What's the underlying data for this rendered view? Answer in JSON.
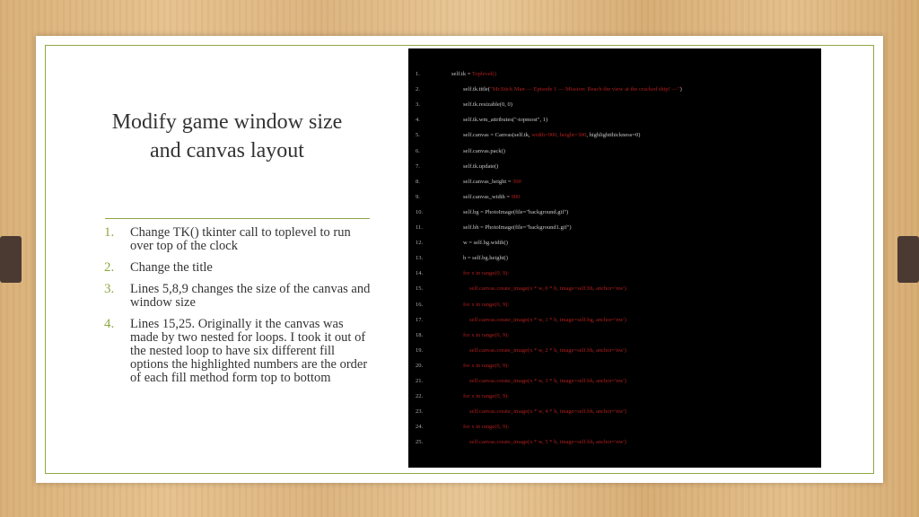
{
  "slide": {
    "title_line1": "Modify game window size",
    "title_line2": "and canvas layout"
  },
  "bullets": [
    {
      "num": "1.",
      "text": "Change TK() tkinter call to toplevel to run over top of the clock"
    },
    {
      "num": "2.",
      "text": "Change the title"
    },
    {
      "num": "3.",
      "text": "Lines 5,8,9 changes the size of the canvas and window size"
    },
    {
      "num": "4.",
      "text": "Lines 15,25. Originally it the canvas was made by two nested for loops. I took it out of the nested loop to have six different fill options the highlighted numbers are the order of each fill method form top to bottom"
    }
  ],
  "code": [
    {
      "ln": "1.",
      "pre": "self.tk = ",
      "red": "Toplevel()",
      "post": ""
    },
    {
      "ln": "2.",
      "pre": "self.tk.title(",
      "red": "\"Mr.Stick Man — Episode 1 — Mission: Reach the view at the cracked ship! —\"",
      "post": ")"
    },
    {
      "ln": "3.",
      "pre": "self.tk.resizable(0, 0)",
      "red": "",
      "post": ""
    },
    {
      "ln": "4.",
      "pre": "self.tk.wm_attributes(\"-topmost\", 1)",
      "red": "",
      "post": ""
    },
    {
      "ln": "5.",
      "pre": "self.canvas = Canvas(self.tk, ",
      "red": "width=900, height=300",
      "post": ", highlightthickness=0)"
    },
    {
      "ln": "6.",
      "pre": "self.canvas.pack()",
      "red": "",
      "post": ""
    },
    {
      "ln": "7.",
      "pre": "self.tk.update()",
      "red": "",
      "post": ""
    },
    {
      "ln": "8.",
      "pre": "self.canvas_height = ",
      "red": "300",
      "post": ""
    },
    {
      "ln": "9.",
      "pre": "self.canvas_width = ",
      "red": "900",
      "post": ""
    },
    {
      "ln": "10.",
      "pre": "self.bg = PhotoImage(file=\"background.gif\")",
      "red": "",
      "post": ""
    },
    {
      "ln": "11.",
      "pre": "self.bh = PhotoImage(file=\"background1.gif\")",
      "red": "",
      "post": ""
    },
    {
      "ln": "12.",
      "pre": "w = self.bg.width()",
      "red": "",
      "post": ""
    },
    {
      "ln": "13.",
      "pre": "h = self.bg.height()",
      "red": "",
      "post": ""
    },
    {
      "ln": "14.",
      "pre": "",
      "red": "for x in range(0, 9):",
      "post": ""
    },
    {
      "ln": "15.",
      "pre": "",
      "red": "self.canvas.create_image(x * w, 0 * h, image=self.bh, anchor='nw')",
      "post": ""
    },
    {
      "ln": "16.",
      "pre": "",
      "red": "for x in range(0, 9):",
      "post": ""
    },
    {
      "ln": "17.",
      "pre": "",
      "red": "self.canvas.create_image(x * w, 1 * h, image=self.bg, anchor='nw')",
      "post": ""
    },
    {
      "ln": "18.",
      "pre": "",
      "red": "for x in range(0, 9):",
      "post": ""
    },
    {
      "ln": "19.",
      "pre": "",
      "red": "self.canvas.create_image(x * w, 2 * h, image=self.bh, anchor='nw')",
      "post": ""
    },
    {
      "ln": "20.",
      "pre": "",
      "red": "for x in range(0, 9):",
      "post": ""
    },
    {
      "ln": "21.",
      "pre": "",
      "red": "self.canvas.create_image(x * w, 3 * h, image=self.bh, anchor='nw')",
      "post": ""
    },
    {
      "ln": "22.",
      "pre": "",
      "red": "for x in range(0, 9):",
      "post": ""
    },
    {
      "ln": "23.",
      "pre": "",
      "red": "self.canvas.create_image(x * w, 4 * h, image=self.bh, anchor='nw')",
      "post": ""
    },
    {
      "ln": "24.",
      "pre": "",
      "red": "for x in range(0, 9):",
      "post": ""
    },
    {
      "ln": "25.",
      "pre": "",
      "red": "self.canvas.create_image(x * w, 5 * h, image=self.bh, anchor='nw')",
      "post": ""
    }
  ],
  "colors": {
    "accent": "#8fa843",
    "text": "#333333",
    "code_bg": "#000000",
    "code_highlight": "#b21f1f"
  }
}
